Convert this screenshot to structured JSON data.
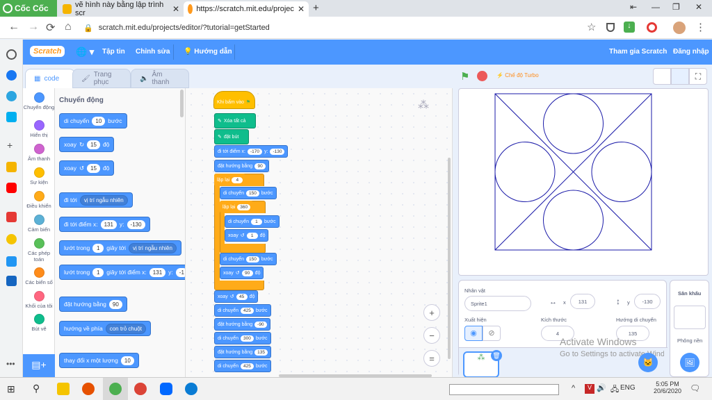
{
  "browser": {
    "brand": "Cốc Cốc",
    "tabs": [
      {
        "title": "vẽ hình này bằng lập trình scr"
      },
      {
        "title": "https://scratch.mit.edu/projec"
      }
    ],
    "new_tab": "+",
    "url": "scratch.mit.edu/projects/editor/?tutorial=getStarted",
    "window_controls": [
      "⇤",
      "—",
      "❐",
      "✕"
    ]
  },
  "menubar": {
    "logo": "Scratch",
    "file": "Tập tin",
    "edit": "Chỉnh sửa",
    "tutorial": "Hướng dẫn",
    "join": "Tham gia Scratch",
    "signin": "Đăng nhập"
  },
  "editor_tabs": {
    "code": "code",
    "costumes": "Trang phục",
    "sounds": "Âm thanh"
  },
  "categories": [
    {
      "label": "Chuyển động",
      "color": "#4c97ff"
    },
    {
      "label": "Hiển thị",
      "color": "#9966ff"
    },
    {
      "label": "Âm thanh",
      "color": "#cf63cf"
    },
    {
      "label": "Sự kiện",
      "color": "#ffbf00"
    },
    {
      "label": "Điều khiển",
      "color": "#ffab19"
    },
    {
      "label": "Cảm biến",
      "color": "#5cb1d6"
    },
    {
      "label": "Các phép toán",
      "color": "#59c059"
    },
    {
      "label": "Các biến số",
      "color": "#ff8c1a"
    },
    {
      "label": "Khối của tôi",
      "color": "#ff6680"
    },
    {
      "label": "Bút vẽ",
      "color": "#0fbd8c"
    }
  ],
  "palette": {
    "heading": "Chuyển động",
    "move": {
      "a": "di chuyển",
      "v": "10",
      "b": "bước"
    },
    "turn_right": {
      "a": "xoay",
      "v": "15",
      "b": "độ"
    },
    "turn_left": {
      "a": "xoay",
      "v": "15",
      "b": "độ"
    },
    "goto": {
      "a": "đi tới",
      "dd": "vị trí ngẫu nhiên"
    },
    "goto_xy": {
      "a": "đi tới điểm x:",
      "x": "131",
      "y_lbl": "y:",
      "y": "-130"
    },
    "glide": {
      "a": "lướt trong",
      "v": "1",
      "b": "giây tới",
      "dd": "vị trí ngẫu nhiên"
    },
    "glide_xy": {
      "a": "lướt trong",
      "v": "1",
      "b": "giây tới điểm x:",
      "x": "131",
      "y_lbl": "y:",
      "y": "-1"
    },
    "point": {
      "a": "đặt hướng bằng",
      "v": "90"
    },
    "point_towards": {
      "a": "hướng về phía",
      "dd": "con trỏ chuột"
    },
    "change_x": {
      "a": "thay đổi x một lượng",
      "v": "10"
    }
  },
  "script": {
    "hat": "Khi bấm vào",
    "erase": "Xóa tất cả",
    "pen_down": "đặt bút",
    "goto_xy": {
      "a": "đi tới điểm x:",
      "x": "-170",
      "y_lbl": "y:",
      "y": "-130"
    },
    "point1": {
      "a": "đặt hướng bằng",
      "v": "90"
    },
    "repeat1": {
      "a": "lặp lại",
      "v": "4"
    },
    "move1": {
      "a": "di chuyển",
      "v": "150",
      "b": "bước"
    },
    "repeat2": {
      "a": "lặp lại",
      "v": "360"
    },
    "move2": {
      "a": "di chuyển",
      "v": "1",
      "b": "bước"
    },
    "turn1": {
      "a": "xoay",
      "v": "1",
      "b": "độ"
    },
    "move3": {
      "a": "di chuyển",
      "v": "150",
      "b": "bước"
    },
    "turn2": {
      "a": "xoay",
      "v": "90",
      "b": "độ"
    },
    "turn3": {
      "a": "xoay",
      "v": "45",
      "b": "độ"
    },
    "move4": {
      "a": "di chuyển",
      "v": "425",
      "b": "bước"
    },
    "point2": {
      "a": "đặt hướng bằng",
      "v": "-90"
    },
    "move5": {
      "a": "di chuyển",
      "v": "300",
      "b": "bước"
    },
    "point3": {
      "a": "đặt hướng bằng",
      "v": "135"
    },
    "move6": {
      "a": "di chuyển",
      "v": "425",
      "b": "bước"
    }
  },
  "zoom": {
    "in": "+",
    "out": "−",
    "reset": "="
  },
  "stage_header": {
    "turbo": "Chế độ Turbo"
  },
  "sprite_info": {
    "sprite_label": "Nhân vật",
    "sprite_name": "Sprite1",
    "x_label": "x",
    "x": "131",
    "y_label": "y",
    "y": "-130",
    "show_label": "Xuất hiện",
    "size_label": "Kích thước",
    "size": "4",
    "direction_label": "Hướng di chuyển",
    "direction": "135"
  },
  "stage_pane": {
    "title": "Sân khấu",
    "backdrops": "Phông nền"
  },
  "watermark": {
    "line1": "Activate Windows",
    "line2": "Go to Settings to activate Windows."
  },
  "taskbar": {
    "time": "5:05 PM",
    "date": "20/6/2020",
    "lang": "ENG"
  }
}
